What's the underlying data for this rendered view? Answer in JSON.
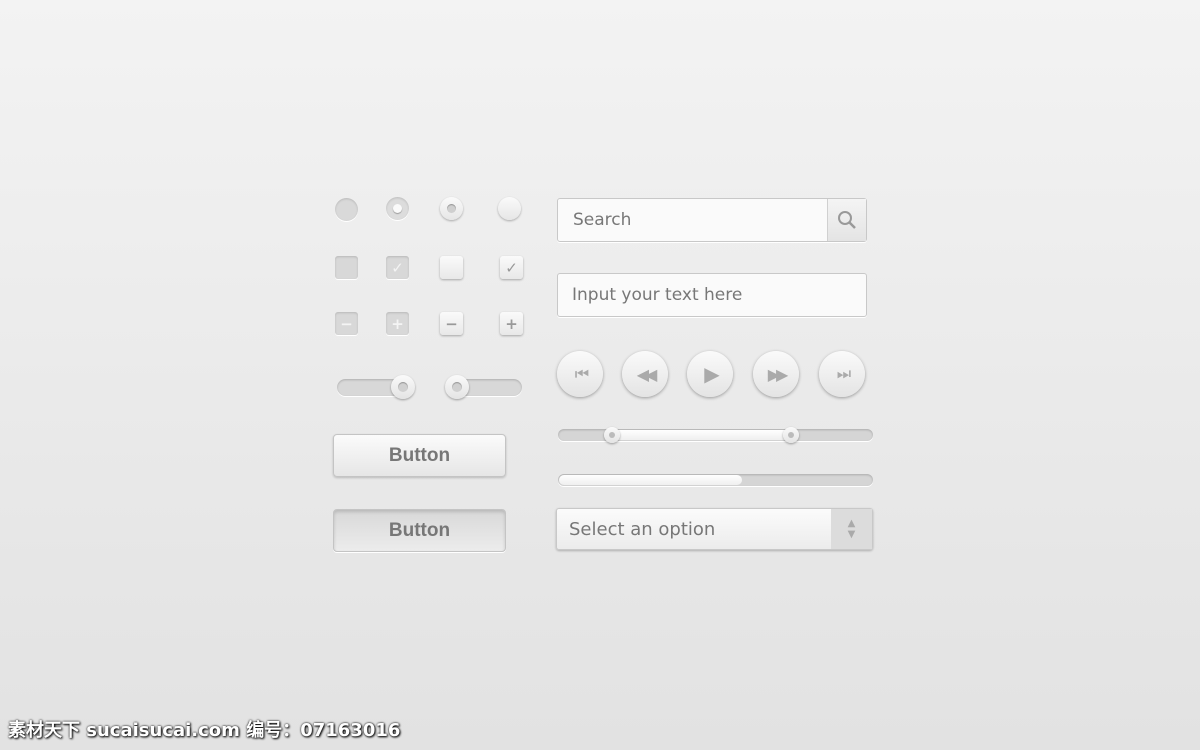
{
  "controls": {
    "sliders": [
      {
        "value_percent": 85
      },
      {
        "value_percent": 15
      }
    ],
    "buttons": [
      {
        "label": "Button",
        "state": "normal"
      },
      {
        "label": "Button",
        "state": "pressed"
      }
    ],
    "checkboxes": [
      {
        "checked": false
      },
      {
        "checked": true
      },
      {
        "checked": false
      },
      {
        "checked": true
      }
    ],
    "checkbox_mark": "✓",
    "steppers": [
      "−",
      "+",
      "−",
      "+"
    ]
  },
  "search": {
    "placeholder": "Search",
    "icon": "search-icon"
  },
  "text_input": {
    "placeholder": "Input your text here"
  },
  "media": [
    {
      "icon": "skip-back-icon",
      "glyph": "⏮"
    },
    {
      "icon": "rewind-icon",
      "glyph": "◀◀"
    },
    {
      "icon": "play-icon",
      "glyph": "▶"
    },
    {
      "icon": "fast-forward-icon",
      "glyph": "▶▶"
    },
    {
      "icon": "skip-forward-icon",
      "glyph": "⏭"
    }
  ],
  "range_slider": {
    "low_percent": 17,
    "high_percent": 74
  },
  "progress": {
    "percent": 58
  },
  "select": {
    "value": "Select an option"
  },
  "watermark": "素材天下 sucaisucai.com  编号：07163016"
}
